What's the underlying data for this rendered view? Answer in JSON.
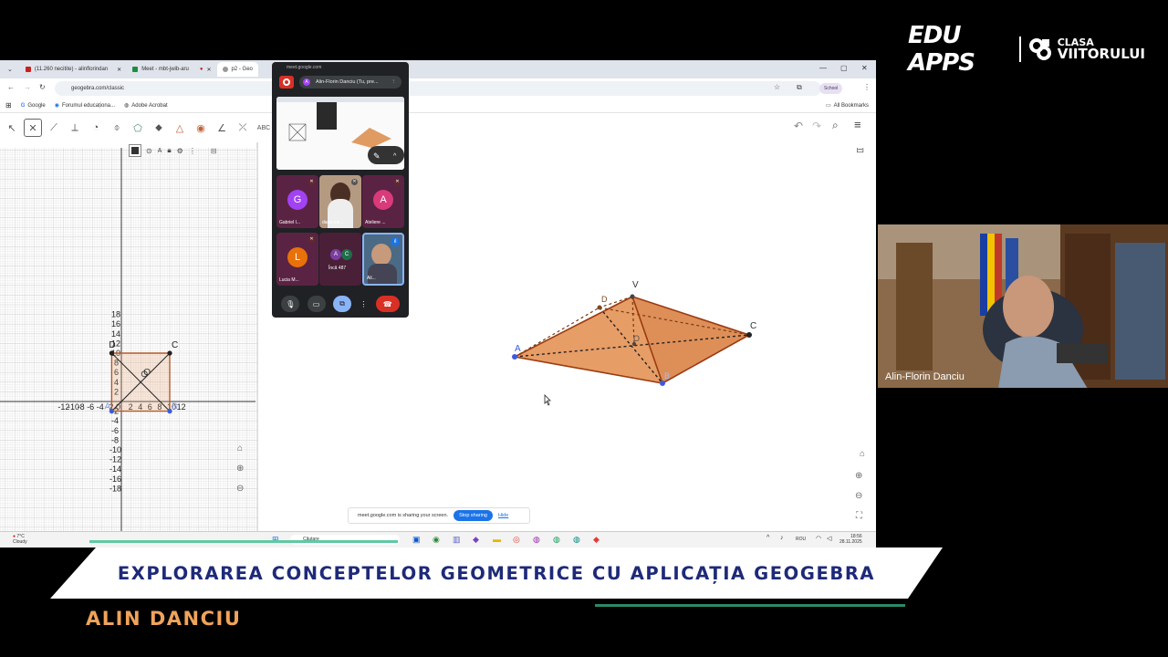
{
  "branding": {
    "main": "EDU APPS",
    "sub_top": "CLASA",
    "sub_bottom": "VIITORULUI"
  },
  "browser": {
    "tabs": [
      {
        "label": "(11.260 necitite) - alinflorindan",
        "color": "#c5221f"
      },
      {
        "label": "Meet - mbt-jwib-aru",
        "color": "#1e8e3e"
      },
      {
        "label": "p2 - Geo",
        "color": "#666666"
      }
    ],
    "url": "geogebra.com/classic",
    "profile": "School",
    "bookmarks": [
      "Google",
      "Forumul educaționa...",
      "Adobe Acrobat"
    ],
    "all_bookmarks": "All Bookmarks"
  },
  "geogebra": {
    "tools": [
      "pointer-icon",
      "line-tool-icon",
      "segment-icon",
      "perpendicular-icon",
      "circle-icon",
      "polygon-icon",
      "cone-icon",
      "pyramid-icon",
      "sphere-icon",
      "angle-icon",
      "reflect-icon",
      "text-tool-icon"
    ],
    "text_tool_label": "ABC",
    "stylebar_aa": "A",
    "x_ticks": [
      "-12",
      "-10",
      "-8",
      "-6",
      "-4",
      "-2",
      "0",
      "2",
      "4",
      "6",
      "8",
      "10",
      "12"
    ],
    "y_ticks": [
      "18",
      "16",
      "14",
      "12",
      "10",
      "8",
      "6",
      "4",
      "2",
      "-2",
      "-4",
      "-6",
      "-8",
      "-10",
      "-12",
      "-14",
      "-16",
      "-18"
    ],
    "square_labels": {
      "A": "A",
      "B": "B",
      "C": "C",
      "D": "D",
      "O": "O"
    },
    "pyramid_labels": {
      "V": "V",
      "A": "A",
      "B": "B",
      "C": "C",
      "D": "D",
      "O": "O"
    }
  },
  "meet": {
    "domain": "meet.google.com",
    "presenter_chip": "Alin-Florin Danciu (Tu, pre...",
    "participants": [
      {
        "initial": "G",
        "name": "Gabriel I...",
        "color": "#a142f4",
        "bg": "#5b2343"
      },
      {
        "initial": "",
        "name": "dana ton...",
        "color": "#777777",
        "bg": "#b59a82"
      },
      {
        "initial": "A",
        "name": "Ateliere ...",
        "color": "#d93a7a",
        "bg": "#5b2343"
      },
      {
        "initial": "L",
        "name": "Lucia M...",
        "color": "#e8710a",
        "bg": "#5b2343"
      },
      {
        "initial": "",
        "name": "Încă 487",
        "color": "#777777",
        "bg": "#4a2038"
      },
      {
        "initial": "",
        "name": "Ali...",
        "color": "#777777",
        "bg": "#4b6a86"
      }
    ],
    "more_initials": [
      "A",
      "C"
    ]
  },
  "sharing": {
    "message": "meet.google.com is sharing your screen.",
    "stop": "Stop sharing",
    "hide": "Hide"
  },
  "taskbar": {
    "weather_temp": "7°C",
    "weather_desc": "Cloudy",
    "search": "Căutare",
    "lang": "ROU",
    "time": "18:56",
    "date": "28.11.2025"
  },
  "webcam": {
    "name": "Alin-Florin Danciu"
  },
  "lower_third": {
    "title": "EXPLORAREA CONCEPTELOR GEOMETRICE CU APLICAȚIA GEOGEBRA",
    "presenter": "ALIN DANCIU"
  }
}
